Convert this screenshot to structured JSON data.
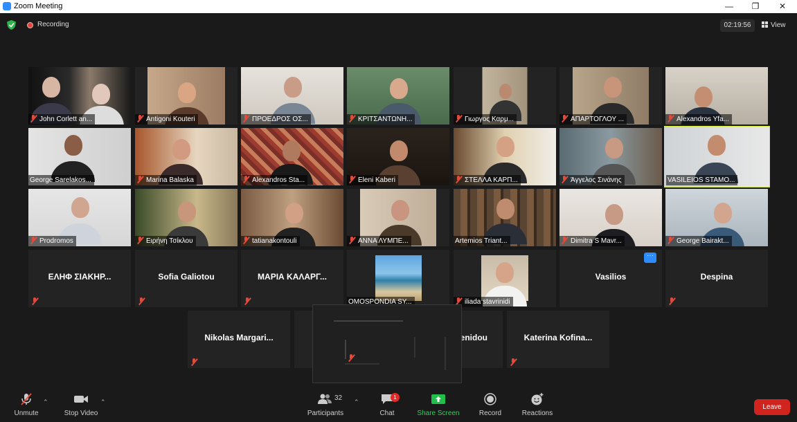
{
  "window": {
    "title": "Zoom Meeting"
  },
  "topbar": {
    "recording_label": "Recording",
    "timer": "02:19:56",
    "view_label": "View"
  },
  "participants": [
    {
      "name": "John Corlett an..."
    },
    {
      "name": "Antigoni Kouteri"
    },
    {
      "name": "ΠΡΟΕΔΡΟΣ ΟΣ..."
    },
    {
      "name": "ΚΡΙΤΣΑΝΤΩΝΗ..."
    },
    {
      "name": "Γιωργος Καρμ..."
    },
    {
      "name": "ΑΠΑΡΤΟΓΛΟΥ ..."
    },
    {
      "name": "Alexandros Yfa..."
    },
    {
      "name": "George Sarelakos..."
    },
    {
      "name": "Marina Balaska"
    },
    {
      "name": "Alexandros Sta..."
    },
    {
      "name": "Eleni Kaberi"
    },
    {
      "name": "ΣΤΕΛΛΑ ΚΑΡΠ..."
    },
    {
      "name": "Άγγελος Σινάνης"
    },
    {
      "name": "VASILEIOS STAMO..."
    },
    {
      "name": "Prodromos"
    },
    {
      "name": "Ειρήνη Τσίκλου"
    },
    {
      "name": "tatianakontouli"
    },
    {
      "name": "ΑΝΝΑ ΛΥΜΠΕ..."
    },
    {
      "name": "Artemios Triant..."
    },
    {
      "name": "Dimitra S Mavr..."
    },
    {
      "name": "George Bairakt..."
    },
    {
      "name": "ΕΛΗΦ ΣΙΑΚΗΡ..."
    },
    {
      "name": "Sofia Galiotou"
    },
    {
      "name": "ΜΑΡΙΑ ΚΑΛΑΡΓ..."
    },
    {
      "name": "OMOSPONDIA SY..."
    },
    {
      "name": "iliada stavrinidi"
    },
    {
      "name": "Vasilios"
    },
    {
      "name": "Despina"
    },
    {
      "name": "Nikolas Margari..."
    },
    {
      "name": "enidou"
    },
    {
      "name": "Katerina Kofina..."
    }
  ],
  "more_options": "···",
  "toolbar": {
    "unmute": "Unmute",
    "stop_video": "Stop Video",
    "participants_count": "32",
    "participants": "Participants",
    "chat": "Chat",
    "chat_badge": "1",
    "share_screen": "Share Screen",
    "record": "Record",
    "reactions": "Reactions",
    "leave": "Leave"
  },
  "colors": {
    "accent": "#2d8cff",
    "active_speaker": "#d7e93a",
    "leave": "#d1241e",
    "share": "#1fbf4a",
    "muted": "#e24a3b"
  },
  "icons": [
    "shield-icon",
    "recording-icon",
    "view-grid-icon",
    "microphone-muted-icon",
    "camera-icon",
    "participants-icon",
    "chat-icon",
    "share-screen-icon",
    "record-icon",
    "reactions-icon"
  ]
}
